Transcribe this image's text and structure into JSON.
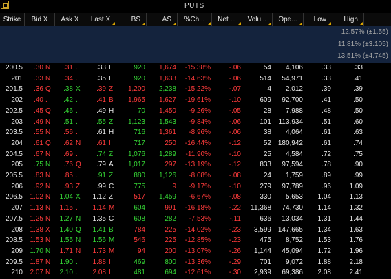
{
  "title": "PUTS",
  "headers": [
    "Strike",
    "Bid X",
    "Ask X",
    "Last X",
    "BS",
    "AS",
    "%Ch...",
    "Net ...",
    "Volu...",
    "Ope...",
    "Low",
    "High"
  ],
  "iv_rows": [
    "12.57% (±1.55)",
    "11.81% (±3.105)",
    "13.51% (±4.745)"
  ],
  "colors": {
    "up": "#35d635",
    "down": "#ff3b3b",
    "neutral": "#e6e6e6",
    "iv_bg": "#14233d"
  },
  "rows": [
    {
      "strike": "200.5",
      "bid": ".30",
      "bidx": "N",
      "ask": ".31",
      "askx": ".",
      "last": ".33",
      "lastx": "I",
      "bs": "920",
      "as": "1,674",
      "pch": "-15.38%",
      "net": "-.06",
      "vol": "54",
      "oi": "4,106",
      "low": ".33",
      "high": ".33",
      "tone": "red"
    },
    {
      "strike": "201",
      "bid": ".33",
      "bidx": "N",
      "ask": ".34",
      "askx": ".",
      "last": ".35",
      "lastx": "I",
      "bs": "920",
      "as": "1,633",
      "pch": "-14.63%",
      "net": "-.06",
      "vol": "514",
      "oi": "54,971",
      "low": ".33",
      "high": ".41",
      "tone": "red"
    },
    {
      "strike": "201.5",
      "bid": ".36",
      "bidx": "Q",
      "ask": ".38",
      "askx": "X",
      "last": ".39",
      "lastx": "Z",
      "bs": "1,200",
      "as": "2,238",
      "pch": "-15.22%",
      "net": "-.07",
      "vol": "4",
      "oi": "2,012",
      "low": ".39",
      "high": ".39",
      "tone": "mix1"
    },
    {
      "strike": "202",
      "bid": ".40",
      "bidx": ".",
      "ask": ".42",
      "askx": ".",
      "last": ".41",
      "lastx": "B",
      "bs": "1,965",
      "as": "1,627",
      "pch": "-19.61%",
      "net": "-.10",
      "vol": "609",
      "oi": "92,700",
      "low": ".41",
      "high": ".50",
      "tone": "mix2"
    },
    {
      "strike": "202.5",
      "bid": ".45",
      "bidx": "Q",
      "ask": ".46",
      "askx": ".",
      "last": ".49",
      "lastx": "H",
      "bs": "70",
      "as": "1,450",
      "pch": "-9.26%",
      "net": "-.05",
      "vol": "28",
      "oi": "7,988",
      "low": ".48",
      "high": ".50",
      "tone": "mix3"
    },
    {
      "strike": "203",
      "bid": ".49",
      "bidx": "N",
      "ask": ".51",
      "askx": ".",
      "last": ".55",
      "lastx": "Z",
      "bs": "1,123",
      "as": "1,543",
      "pch": "-9.84%",
      "net": "-.06",
      "vol": "101",
      "oi": "113,934",
      "low": ".51",
      "high": ".60",
      "tone": "mix4"
    },
    {
      "strike": "203.5",
      "bid": ".55",
      "bidx": "N",
      "ask": ".56",
      "askx": ".",
      "last": ".61",
      "lastx": "H",
      "bs": "716",
      "as": "1,361",
      "pch": "-8.96%",
      "net": "-.06",
      "vol": "38",
      "oi": "4,064",
      "low": ".61",
      "high": ".63",
      "tone": "red"
    },
    {
      "strike": "204",
      "bid": ".61",
      "bidx": "Q",
      "ask": ".62",
      "askx": "N",
      "last": ".61",
      "lastx": "I",
      "bs": "717",
      "as": "250",
      "pch": "-16.44%",
      "net": "-.12",
      "vol": "52",
      "oi": "180,942",
      "low": ".61",
      "high": ".74",
      "tone": "mix5"
    },
    {
      "strike": "204.5",
      "bid": ".67",
      "bidx": "N",
      "ask": ".69",
      "askx": ".",
      "last": ".74",
      "lastx": "Z",
      "bs": "1,076",
      "as": "1,289",
      "pch": "-11.90%",
      "net": "-.10",
      "vol": "25",
      "oi": "4,584",
      "low": ".72",
      "high": ".75",
      "tone": "mix6"
    },
    {
      "strike": "205",
      "bid": ".75",
      "bidx": "N",
      "ask": ".76",
      "askx": "Q",
      "last": ".79",
      "lastx": "A",
      "bs": "1,017",
      "as": "297",
      "pch": "-13.19%",
      "net": "-.12",
      "vol": "833",
      "oi": "97,594",
      "low": ".78",
      "high": ".90",
      "tone": "mix7"
    },
    {
      "strike": "205.5",
      "bid": ".83",
      "bidx": "N",
      "ask": ".85",
      "askx": ".",
      "last": ".91",
      "lastx": "Z",
      "bs": "880",
      "as": "1,126",
      "pch": "-8.08%",
      "net": "-.08",
      "vol": "24",
      "oi": "1,759",
      "low": ".89",
      "high": ".99",
      "tone": "mix6"
    },
    {
      "strike": "206",
      "bid": ".92",
      "bidx": "N",
      "ask": ".93",
      "askx": "Z",
      "last": ".99",
      "lastx": "C",
      "bs": "775",
      "as": "9",
      "pch": "-9.17%",
      "net": "-.10",
      "vol": "279",
      "oi": "97,789",
      "low": ".96",
      "high": "1.09",
      "tone": "mix8"
    },
    {
      "strike": "206.5",
      "bid": "1.02",
      "bidx": "N",
      "ask": "1.04",
      "askx": "X",
      "last": "1.12",
      "lastx": "Z",
      "bs": "517",
      "as": "1,459",
      "pch": "-6.67%",
      "net": "-.08",
      "vol": "330",
      "oi": "5,653",
      "low": "1.04",
      "high": "1.13",
      "tone": "mix9"
    },
    {
      "strike": "207",
      "bid": "1.13",
      "bidx": "N",
      "ask": "1.15",
      "askx": ".",
      "last": "1.14",
      "lastx": "M",
      "bs": "604",
      "as": "991",
      "pch": "-16.18%",
      "net": "-.22",
      "vol": "11,368",
      "oi": "74,730",
      "low": "1.14",
      "high": "1.32",
      "tone": "mix10"
    },
    {
      "strike": "207.5",
      "bid": "1.25",
      "bidx": "N",
      "ask": "1.27",
      "askx": "N",
      "last": "1.35",
      "lastx": "C",
      "bs": "608",
      "as": "282",
      "pch": "-7.53%",
      "net": "-.11",
      "vol": "636",
      "oi": "13,034",
      "low": "1.31",
      "high": "1.44",
      "tone": "mix11"
    },
    {
      "strike": "208",
      "bid": "1.38",
      "bidx": "X",
      "ask": "1.40",
      "askx": "Q",
      "last": "1.41",
      "lastx": "B",
      "bs": "784",
      "as": "225",
      "pch": "-14.02%",
      "net": "-.23",
      "vol": "3,599",
      "oi": "147,665",
      "low": "1.34",
      "high": "1.63",
      "tone": "mix12"
    },
    {
      "strike": "208.5",
      "bid": "1.53",
      "bidx": "N",
      "ask": "1.55",
      "askx": "N",
      "last": "1.56",
      "lastx": "M",
      "bs": "546",
      "as": "225",
      "pch": "-12.85%",
      "net": "-.23",
      "vol": "475",
      "oi": "8,752",
      "low": "1.53",
      "high": "1.76",
      "tone": "mix12"
    },
    {
      "strike": "209",
      "bid": "1.70",
      "bidx": "N",
      "ask": "1.71",
      "askx": "N",
      "last": "1.73",
      "lastx": "M",
      "bs": "94",
      "as": "200",
      "pch": "-13.07%",
      "net": "-.26",
      "vol": "1,144",
      "oi": "45,094",
      "low": "1.72",
      "high": "1.96",
      "tone": "mix13"
    },
    {
      "strike": "209.5",
      "bid": "1.87",
      "bidx": "N",
      "ask": "1.90",
      "askx": ".",
      "last": "1.88",
      "lastx": "I",
      "bs": "469",
      "as": "800",
      "pch": "-13.36%",
      "net": "-.29",
      "vol": "701",
      "oi": "9,072",
      "low": "1.88",
      "high": "2.18",
      "tone": "mix14"
    },
    {
      "strike": "210",
      "bid": "2.07",
      "bidx": "N",
      "ask": "2.10",
      "askx": ".",
      "last": "2.08",
      "lastx": "I",
      "bs": "481",
      "as": "694",
      "pch": "-12.61%",
      "net": "-.30",
      "vol": "2,939",
      "oi": "69,386",
      "low": "2.08",
      "high": "2.41",
      "tone": "mix14"
    }
  ]
}
